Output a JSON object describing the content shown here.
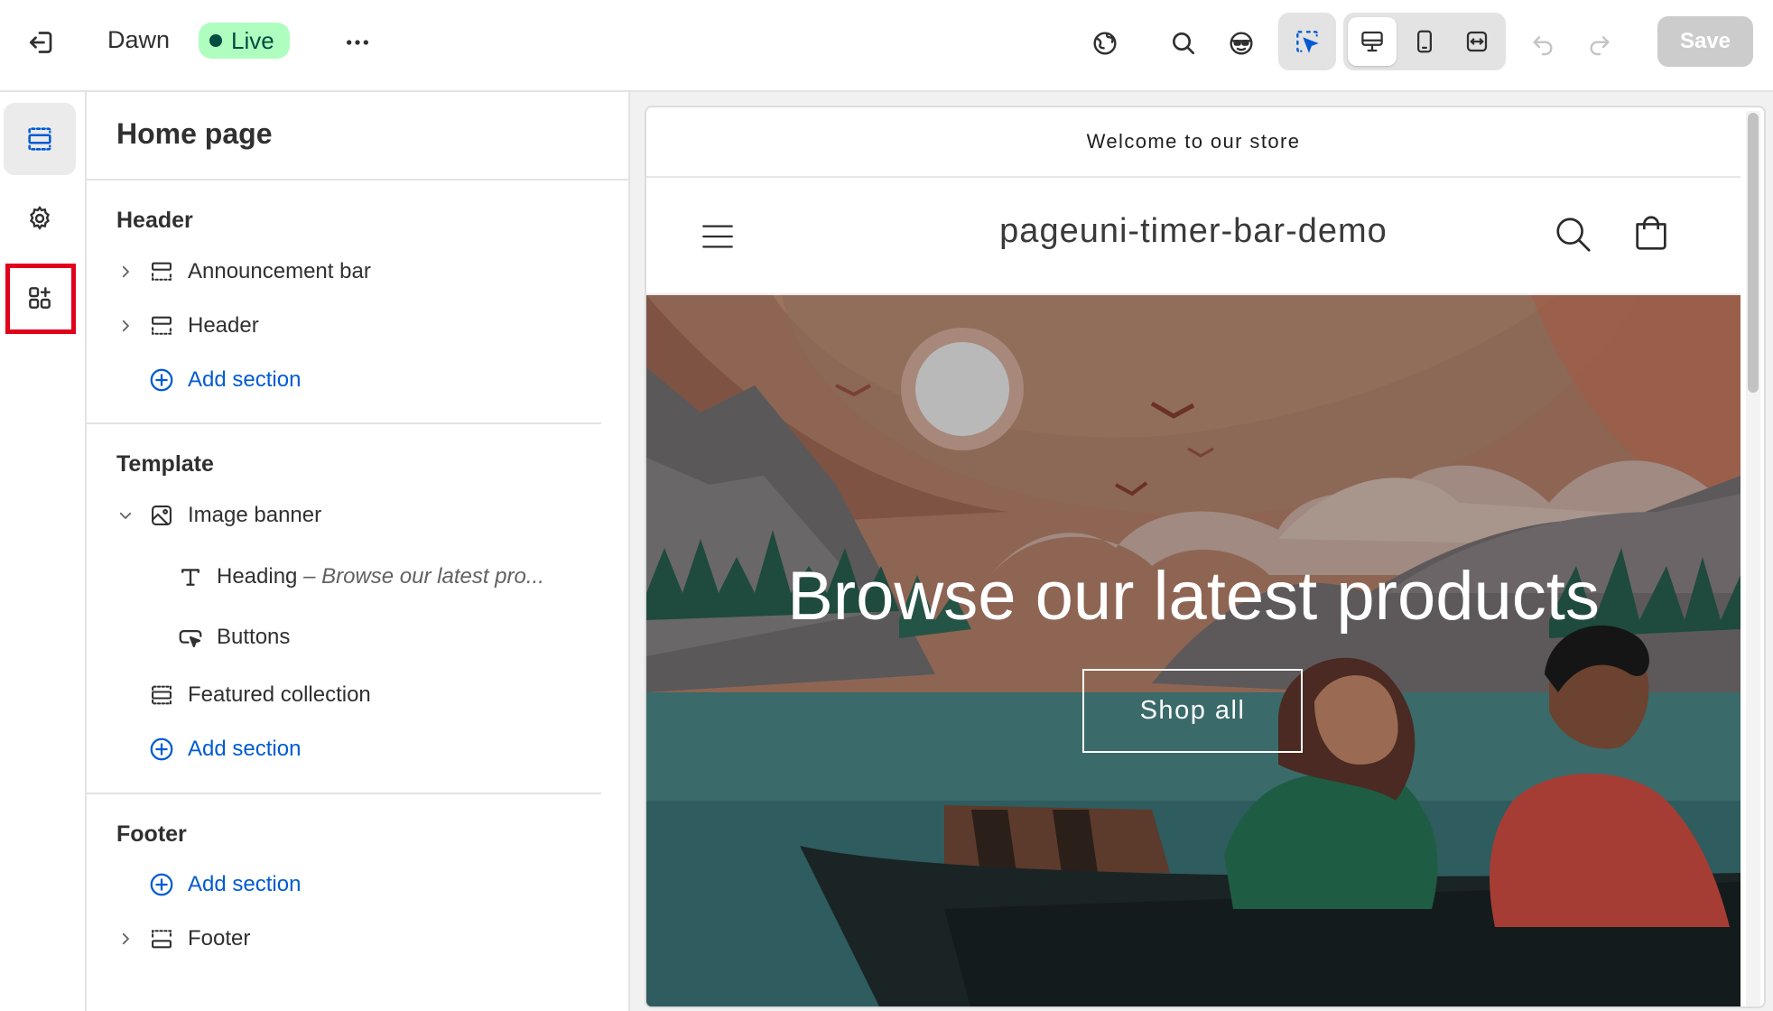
{
  "topbar": {
    "theme_name": "Dawn",
    "status_badge": "Live",
    "save_label": "Save"
  },
  "panel": {
    "title": "Home page",
    "groups": {
      "header": {
        "title": "Header",
        "items": [
          "Announcement bar",
          "Header"
        ],
        "add_label": "Add section"
      },
      "template": {
        "title": "Template",
        "image_banner": "Image banner",
        "heading_label": "Heading",
        "heading_sub": "– Browse our latest pro...",
        "buttons_label": "Buttons",
        "featured": "Featured collection",
        "add_label": "Add section"
      },
      "footer": {
        "title": "Footer",
        "add_label": "Add section",
        "item": "Footer"
      }
    }
  },
  "preview": {
    "announcement": "Welcome to our store",
    "store_name": "pageuni-timer-bar-demo",
    "banner_heading": "Browse our latest products",
    "banner_button": "Shop all"
  },
  "colors": {
    "accent_blue": "#005bd3",
    "live_badge_bg": "#affebf",
    "highlight_red": "#e0001b"
  },
  "icons": {
    "exit": "exit-icon",
    "more": "more-horizontal-icon",
    "globe": "globe-icon",
    "search": "search-icon",
    "accessibility": "ai-agent-icon",
    "inspector": "select-cursor-icon",
    "desktop": "desktop-icon",
    "mobile": "mobile-icon",
    "fullwidth": "full-width-icon",
    "undo": "undo-icon",
    "redo": "redo-icon",
    "sections": "sections-icon",
    "settings": "gear-icon",
    "apps": "apps-add-icon"
  }
}
